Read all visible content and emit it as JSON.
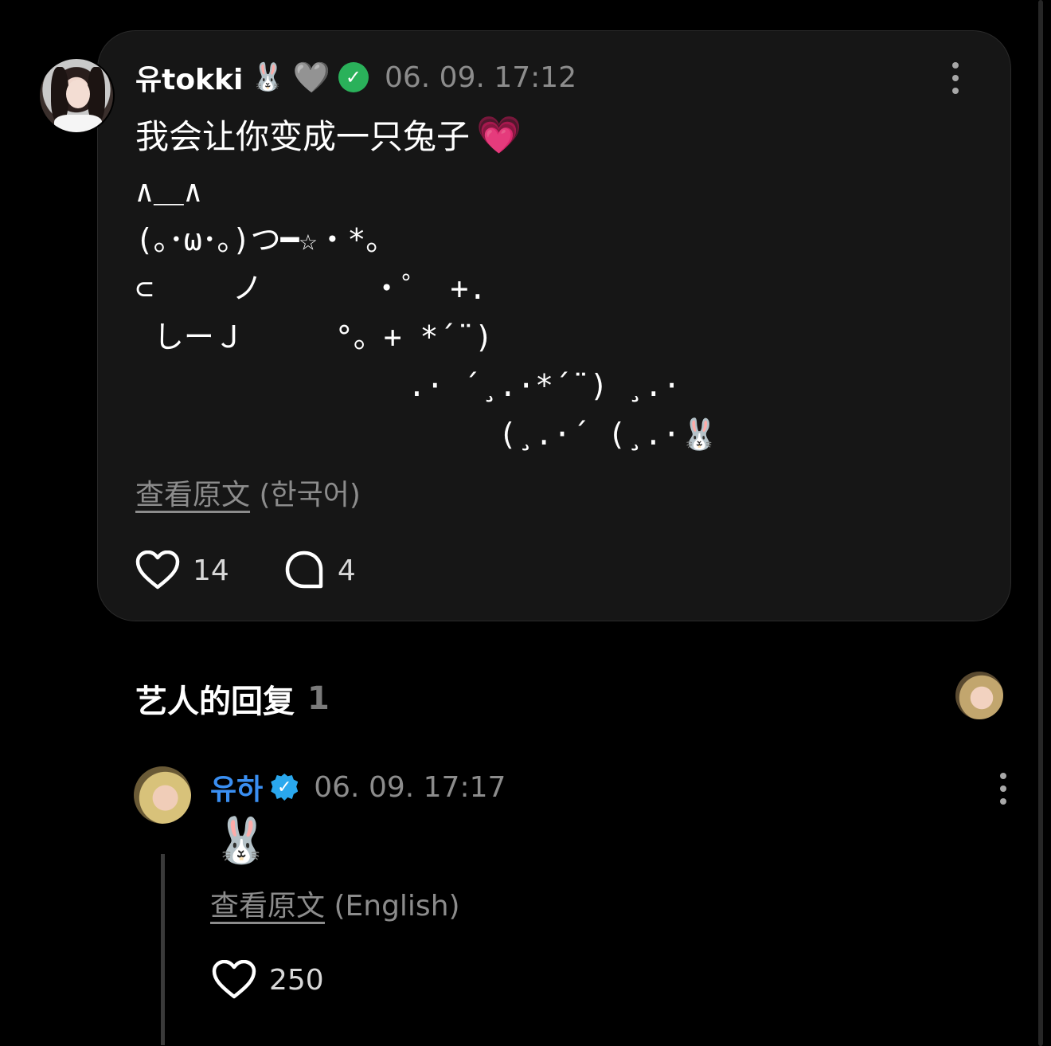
{
  "post": {
    "username": "유tokki",
    "rabbit_emoji": "🐰",
    "grey_heart": "🩶",
    "verified_check": "✓",
    "timestamp": "06. 09. 17:12",
    "text": "我会让你变成一只兔子",
    "pink_heart_emoji": "💗",
    "ascii_art": "∧＿∧\n(｡･ω･｡)つ━☆・*。\n⊂　　 ノ 　　　・゜ +.\n しーＪ　　　°。+ *´¨)\n　　　　　　　　　.· ´¸.·*´¨) ¸.·\n　　　　　　　　　　　　(¸.·´ (¸.·🐰",
    "view_original": "查看原文",
    "view_original_lang": "(한국어)",
    "likes": "14",
    "comments": "4"
  },
  "artist_replies": {
    "title": "艺人的回复",
    "count": "1"
  },
  "reply": {
    "username": "유하",
    "verified_check": "✓",
    "timestamp": "06. 09. 17:17",
    "emoji": "🐰",
    "view_original": "查看原文",
    "view_original_lang": "(English)",
    "likes": "250"
  },
  "colors": {
    "background": "#000000",
    "card": "#161616",
    "muted_text": "#8c8c8c",
    "reply_username": "#3a8ff2",
    "verified_green": "#2ab15a",
    "verified_blue": "#2aa8ee"
  }
}
